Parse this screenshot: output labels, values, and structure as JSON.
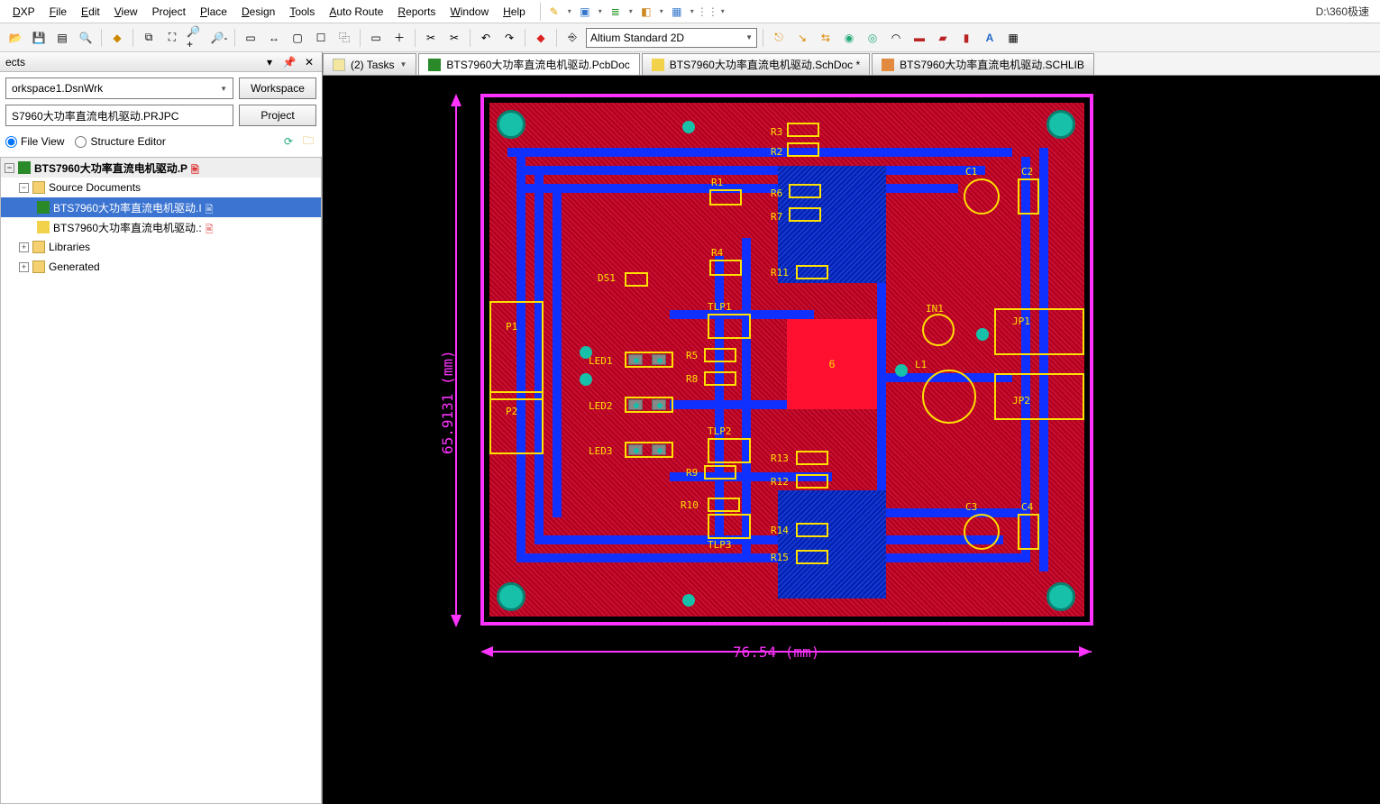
{
  "menubar": {
    "items": [
      "DXP",
      "File",
      "Edit",
      "View",
      "Project",
      "Place",
      "Design",
      "Tools",
      "Auto Route",
      "Reports",
      "Window",
      "Help"
    ],
    "path": "D:\\360极速"
  },
  "toolbar": {
    "view_mode": "Altium Standard 2D"
  },
  "panel": {
    "title": "ects",
    "workspace_combo": "orkspace1.DsnWrk",
    "workspace_btn": "Workspace",
    "project_combo": "S7960大功率直流电机驱动.PRJPC",
    "project_btn": "Project",
    "radio_file_view": "File View",
    "radio_structure": "Structure Editor",
    "tree": {
      "root": "BTS7960大功率直流电机驱动.P",
      "src_label": "Source Documents",
      "doc1": "BTS7960大功率直流电机驱动.I",
      "doc2": "BTS7960大功率直流电机驱动.:",
      "libraries": "Libraries",
      "generated": "Generated"
    }
  },
  "tabs": {
    "tasks": "(2) Tasks",
    "pcb": "BTS7960大功率直流电机驱动.PcbDoc",
    "sch": "BTS7960大功率直流电机驱动.SchDoc *",
    "schlib": "BTS7960大功率直流电机驱动.SCHLIB"
  },
  "pcb": {
    "dim_h": "76.54 (mm)",
    "dim_v": "65.9131 (mm)",
    "components": {
      "R1": "R1",
      "R2": "R2",
      "R3": "R3",
      "R4": "R4",
      "R5": "R5",
      "R6": "R6",
      "R7": "R7",
      "R8": "R8",
      "R9": "R9",
      "R10": "R10",
      "R11": "R11",
      "R12": "R12",
      "R13": "R13",
      "R14": "R14",
      "R15": "R15",
      "C1": "C1",
      "C2": "C2",
      "C3": "C3",
      "C4": "C4",
      "DS1": "DS1",
      "TLP1": "TLP1",
      "TLP2": "TLP2",
      "TLP3": "TLP3",
      "LED1": "LED1",
      "LED2": "LED2",
      "LED3": "LED3",
      "P1": "P1",
      "P2": "P2",
      "JP1": "JP1",
      "JP2": "JP2",
      "IN1": "IN1",
      "L1": "L1",
      "U6": "6"
    }
  }
}
